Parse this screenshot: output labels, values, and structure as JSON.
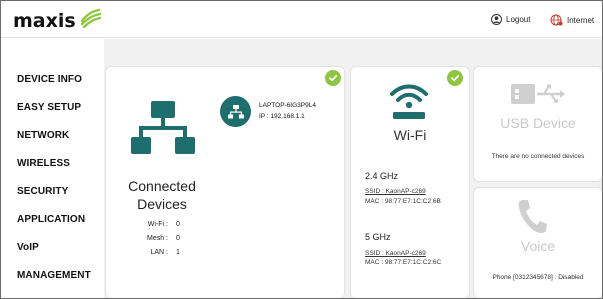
{
  "brand": {
    "logo_text": "maxis",
    "accent": "#8dc63f",
    "teal": "#1e6e6e"
  },
  "header": {
    "logout_label": "Logout",
    "internet_label": "Internet"
  },
  "sidebar": {
    "items": [
      {
        "label": "DEVICE INFO"
      },
      {
        "label": "EASY SETUP"
      },
      {
        "label": "NETWORK"
      },
      {
        "label": "WIRELESS"
      },
      {
        "label": "SECURITY"
      },
      {
        "label": "APPLICATION"
      },
      {
        "label": "VoIP"
      },
      {
        "label": "MANAGEMENT"
      }
    ]
  },
  "connected_devices": {
    "title_line1": "Connected",
    "title_line2": "Devices",
    "status_icon": "check-icon",
    "device": {
      "name": "LAPTOP-6IG3P9L4",
      "ip": "IP : 192.168.1.1"
    },
    "stats": [
      {
        "label": "Wi-Fi :",
        "value": "0"
      },
      {
        "label": "Mesh :",
        "value": "0"
      },
      {
        "label": "LAN :",
        "value": "1"
      }
    ]
  },
  "wifi": {
    "title": "Wi-Fi",
    "status_icon": "check-icon",
    "bands": [
      {
        "band": "2.4 GHz",
        "ssid": "SSID : KaonAP-c269",
        "mac": "MAC : 98:77:E7:1C:C2:6B"
      },
      {
        "band": "5 GHz",
        "ssid": "SSID : KaonAP-c269",
        "mac": "MAC : 98:77:E7:1C:C2:6C"
      }
    ]
  },
  "usb": {
    "title": "USB Device",
    "message": "There are no connected devices"
  },
  "voice": {
    "title": "Voice",
    "message": "Phone [0312345678] : Disabled"
  }
}
